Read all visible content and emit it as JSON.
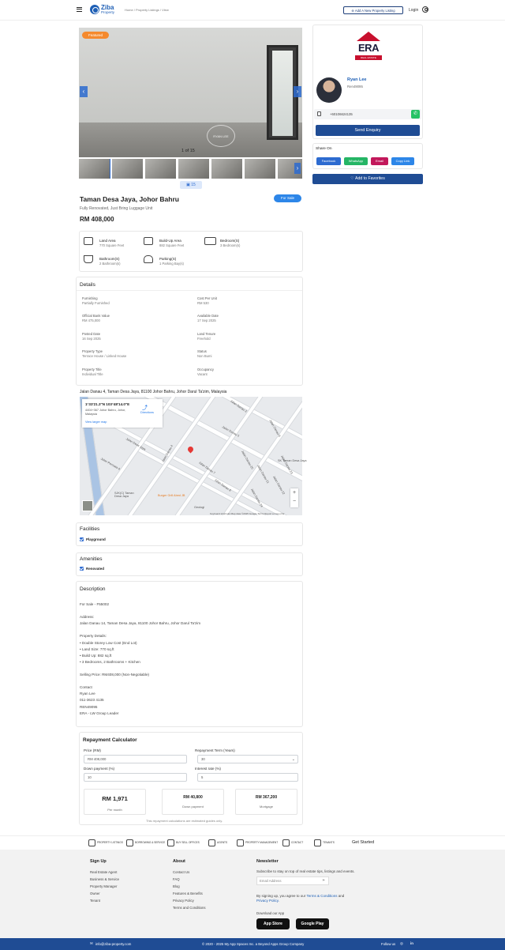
{
  "header": {
    "logo_name": "Ziba",
    "logo_sub": "Property",
    "breadcrumb": "Home  /  Property Listings  /  View",
    "add_listing": "Add A New Property Listing",
    "login": "Login"
  },
  "gallery": {
    "badge": "Featured",
    "watermark": "RYAN LEE",
    "counter": "1 of 15",
    "photo_count": "15",
    "prev": "‹",
    "next": "›"
  },
  "listing": {
    "title": "Taman Desa Jaya, Johor Bahru",
    "subtitle": "Fully Renovated, Just Bring Luggage Unit",
    "price": "RM 408,000",
    "status": "For Sale"
  },
  "facts": [
    {
      "label": "Land Area",
      "value": "770 Square Feet",
      "icon": "land-area-icon"
    },
    {
      "label": "Build-Up Area",
      "value": "882 Square Feet",
      "icon": "house-icon"
    },
    {
      "label": "Bedroom(S)",
      "value": "3 Bedroom(s)",
      "icon": "bed-icon"
    },
    {
      "label": "Bathroom(S)",
      "value": "2 Bathroom(s)",
      "icon": "bath-icon"
    },
    {
      "label": "Parking(S)",
      "value": "1 Parking Bay(s)",
      "icon": "car-icon"
    }
  ],
  "details": {
    "title": "Details",
    "items": [
      {
        "label": "Furnishing",
        "value": "Partially Furnished"
      },
      {
        "label": "Cost Per Unit",
        "value": "RM 530"
      },
      {
        "label": "Official Bank Value",
        "value": "RM 475,000"
      },
      {
        "label": "Available Date",
        "value": "17 Sep 2025"
      },
      {
        "label": "Posted Date",
        "value": "16 Sep 2025"
      },
      {
        "label": "Land Tenure",
        "value": "Freehold"
      },
      {
        "label": "Property Type",
        "value": "Terrace House / Linked House"
      },
      {
        "label": "Status",
        "value": "Non Bumi"
      },
      {
        "label": "Property Title",
        "value": "Individual Title"
      },
      {
        "label": "Occupancy",
        "value": "Vacant"
      }
    ]
  },
  "map": {
    "address": "Jalan Danau 4, Taman Desa Jaya, 81100 Johor Bahru, Johor Darul Ta'zim, Malaysia",
    "coords": "1°33'21.3\"N 103°48'14.0\"E",
    "card_addr": "4404+367 Johor Bahru, Johor, Malaysia",
    "directions": "Directions",
    "larger_map": "View larger map",
    "streets": [
      "Jalan Danau 3",
      "Jalan Danau 6",
      "Jalan Danau 5",
      "Jalan Danau 4",
      "Jalan Danau 20",
      "Jalan Danau 21",
      "Jalan Danau 22",
      "Jalan Danau 23",
      "Jalan Danau 24",
      "Jalan Desa Jaya",
      "Jalan Permata 9",
      "Jalan Danau 7",
      "Jalan Danau 8"
    ],
    "poi": [
      "Burger Grill Abed JB",
      "SK Taman Desa Jaya",
      "SJK(C) Taman Desa Jaya",
      "Geologi"
    ],
    "attribution": "Keyboard shortcuts   Map data ©2025 Google   Terms   Report a map error",
    "zoom_in": "+",
    "zoom_out": "−"
  },
  "facilities": {
    "title": "Facilities",
    "items": [
      "Playground"
    ]
  },
  "amenities": {
    "title": "Amenities",
    "items": [
      "Renovated"
    ]
  },
  "description": {
    "title": "Description",
    "body": "For Sale - F55002\n\nAddress:\nJalan Danau 14, Taman Desa Jaya, 81100 Johor Bahru, Johor Darul Ta'zim\n\nProperty Details:\n• Double Storey Low Cost (End Lot)\n• Land Size: 770 sq.ft\n• Build Up: 882 sq.ft\n• 3 Bedrooms, 2 Bathrooms + Kitchen\n\nSelling Price: RM408,000 (Non-Negotiable)\n\nContact\nRyan Lee\n011-3623 4135\nREN49095\nERA - LW Group Leader"
  },
  "calculator": {
    "title": "Repayment Calculator",
    "price_label": "Price (RM)",
    "price_value": "RM   408,000",
    "term_label": "Repayment Term (Years)",
    "term_value": "30",
    "down_label": "Down payment (%)",
    "down_value": "10",
    "interest_label": "Interest rate (%)",
    "interest_value": "5",
    "monthly_value": "RM 1,971",
    "monthly_label": "Per month",
    "down_amount": "RM 40,800",
    "down_amount_label": "Down payment",
    "mortgage": "RM 367,200",
    "mortgage_label": "Mortgage",
    "note": "This repayment calculations are estimated guides only."
  },
  "agent": {
    "agency": "ERA",
    "agency_sub": "REAL ESTATE",
    "name": "Ryan Lee",
    "reg": "Ren49095",
    "phone": "+60106624135",
    "enquiry": "Send Enquiry",
    "share_label": "Share On",
    "share": [
      {
        "label": "Facebook",
        "color": "#2d6bd0"
      },
      {
        "label": "WhatsApp",
        "color": "#25b565"
      },
      {
        "label": "Email",
        "color": "#c2185b"
      },
      {
        "label": "Copy Link",
        "color": "#2d86e8"
      }
    ],
    "favorite": "Add to Favorites"
  },
  "strip": {
    "items": [
      "PROPERTY LISTINGS",
      "BORROWING & SERVICE",
      "BUY SELL OFFICES",
      "AGENTS",
      "PROPERTY MANAGEMENT",
      "CONTACT",
      "TENANTS"
    ],
    "get_started": "Get Started"
  },
  "footer": {
    "signup_title": "Sign Up",
    "signup_links": [
      "Real Estate Agent",
      "Business & Service",
      "Property Manager",
      "Owner",
      "Tenant"
    ],
    "about_title": "About",
    "about_links": [
      "Contact Us",
      "FAQ",
      "Blog",
      "Features & Benefits",
      "Privacy Policy",
      "Terms and Conditions"
    ],
    "newsletter_title": "Newsletter",
    "newsletter_text": "Subscribe to stay on top of real estate tips, listings and events.",
    "email_placeholder": "Email Address",
    "consent_pre": "By signing up, you agree to our",
    "consent_terms": "Terms & Conditions",
    "consent_and": "and",
    "consent_privacy": "Privacy Policy.",
    "download": "Download our App",
    "app_store": "App Store",
    "google_play": "Google Play",
    "email": "info@ziba-property.com",
    "copyright": "© 2020 - 2025 My App Spaces Inc. a Beyond Apps Group Company",
    "follow": "Follow us"
  }
}
